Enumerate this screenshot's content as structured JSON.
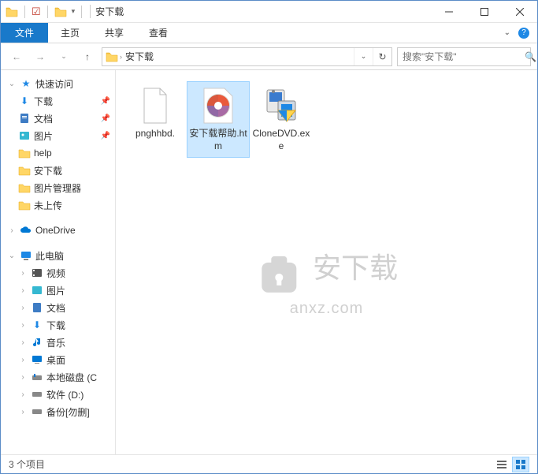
{
  "window": {
    "title": "安下载"
  },
  "ribbon": {
    "file": "文件",
    "tabs": [
      "主页",
      "共享",
      "查看"
    ]
  },
  "address": {
    "crumbs": [
      "安下载"
    ],
    "search_placeholder": "搜索\"安下载\""
  },
  "sidebar": {
    "quick_access": "快速访问",
    "items": [
      {
        "label": "下载"
      },
      {
        "label": "文档"
      },
      {
        "label": "图片"
      },
      {
        "label": "help"
      },
      {
        "label": "安下载"
      },
      {
        "label": "图片管理器"
      },
      {
        "label": "未上传"
      }
    ],
    "onedrive": "OneDrive",
    "this_pc": "此电脑",
    "pc_items": [
      {
        "label": "视频"
      },
      {
        "label": "图片"
      },
      {
        "label": "文档"
      },
      {
        "label": "下载"
      },
      {
        "label": "音乐"
      },
      {
        "label": "桌面"
      },
      {
        "label": "本地磁盘 (C"
      },
      {
        "label": "软件 (D:)"
      },
      {
        "label": "备份[勿删]"
      }
    ]
  },
  "files": [
    {
      "name": "pnghhbd."
    },
    {
      "name": "安下载帮助.htm"
    },
    {
      "name": "CloneDVD.exe"
    }
  ],
  "watermark": {
    "main": "安下载",
    "sub": "anxz.com"
  },
  "status": {
    "count": "3 个项目"
  }
}
